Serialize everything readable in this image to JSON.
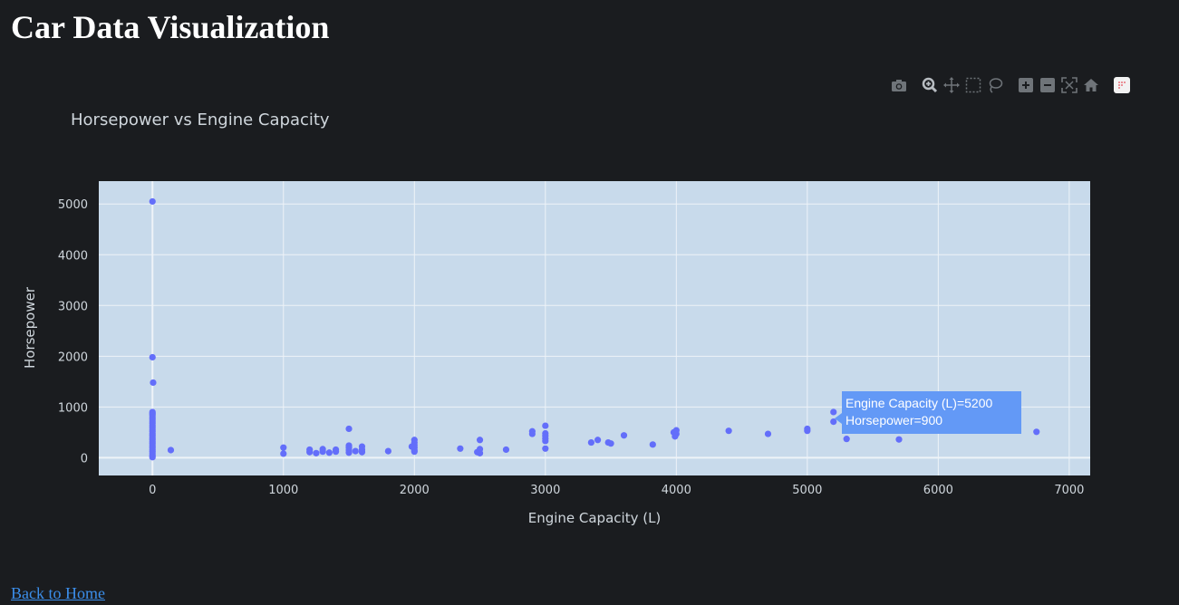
{
  "page": {
    "title": "Car Data Visualization",
    "back_link": "Back to Home"
  },
  "modebar": {
    "buttons": [
      "camera-icon",
      "zoom-icon",
      "pan-icon",
      "box-select-icon",
      "lasso-icon",
      "zoom-in-icon",
      "zoom-out-icon",
      "autoscale-icon",
      "reset-axes-icon",
      "plotly-logo-icon"
    ]
  },
  "hover": {
    "line1": "Engine Capacity (L)=5200",
    "line2": "Horsepower=900"
  },
  "chart_data": {
    "type": "scatter",
    "title": "Horsepower vs Engine Capacity",
    "xlabel": "Engine Capacity (L)",
    "ylabel": "Horsepower",
    "xlim": [
      -410,
      7160
    ],
    "ylim": [
      -350,
      5450
    ],
    "xticks": [
      0,
      1000,
      2000,
      3000,
      4000,
      5000,
      6000,
      7000
    ],
    "xtick_labels": [
      "0",
      "1000",
      "2000",
      "3000",
      "4000",
      "5000",
      "6000",
      "7000"
    ],
    "yticks": [
      0,
      1000,
      2000,
      3000,
      4000,
      5000
    ],
    "ytick_labels": [
      "0",
      "1000",
      "2000",
      "3000",
      "4000",
      "5000"
    ],
    "grid": true,
    "legend": "none",
    "colors": {
      "page_bg": "#1a1c1f",
      "plot_bg": "#c8daeb",
      "grid": "#eef3f8",
      "marker": "#636efa",
      "text": "#cfd6dc"
    },
    "points": [
      [
        0,
        5050
      ],
      [
        0,
        1980
      ],
      [
        5,
        1480
      ],
      [
        0,
        900
      ],
      [
        0,
        870
      ],
      [
        0,
        840
      ],
      [
        0,
        800
      ],
      [
        0,
        760
      ],
      [
        0,
        720
      ],
      [
        0,
        680
      ],
      [
        0,
        640
      ],
      [
        0,
        600
      ],
      [
        0,
        560
      ],
      [
        0,
        520
      ],
      [
        0,
        480
      ],
      [
        0,
        440
      ],
      [
        0,
        400
      ],
      [
        0,
        360
      ],
      [
        0,
        320
      ],
      [
        0,
        280
      ],
      [
        0,
        240
      ],
      [
        0,
        200
      ],
      [
        0,
        160
      ],
      [
        0,
        120
      ],
      [
        0,
        80
      ],
      [
        0,
        40
      ],
      [
        0,
        10
      ],
      [
        140,
        150
      ],
      [
        1000,
        200
      ],
      [
        1000,
        80
      ],
      [
        1200,
        160
      ],
      [
        1200,
        110
      ],
      [
        1250,
        90
      ],
      [
        1300,
        170
      ],
      [
        1300,
        120
      ],
      [
        1350,
        100
      ],
      [
        1400,
        160
      ],
      [
        1400,
        120
      ],
      [
        1500,
        570
      ],
      [
        1500,
        240
      ],
      [
        1500,
        200
      ],
      [
        1500,
        150
      ],
      [
        1500,
        100
      ],
      [
        1550,
        130
      ],
      [
        1600,
        220
      ],
      [
        1600,
        160
      ],
      [
        1600,
        110
      ],
      [
        1800,
        130
      ],
      [
        1980,
        220
      ],
      [
        2000,
        350
      ],
      [
        2000,
        300
      ],
      [
        2000,
        250
      ],
      [
        2000,
        200
      ],
      [
        2000,
        150
      ],
      [
        2000,
        120
      ],
      [
        2350,
        180
      ],
      [
        2500,
        350
      ],
      [
        2500,
        170
      ],
      [
        2480,
        110
      ],
      [
        2500,
        90
      ],
      [
        2700,
        160
      ],
      [
        2900,
        520
      ],
      [
        2900,
        470
      ],
      [
        3000,
        630
      ],
      [
        3000,
        480
      ],
      [
        3000,
        430
      ],
      [
        3000,
        380
      ],
      [
        3000,
        330
      ],
      [
        3000,
        180
      ],
      [
        3350,
        300
      ],
      [
        3400,
        350
      ],
      [
        3480,
        300
      ],
      [
        3500,
        280
      ],
      [
        3600,
        440
      ],
      [
        3820,
        260
      ],
      [
        4000,
        540
      ],
      [
        3980,
        500
      ],
      [
        4000,
        470
      ],
      [
        3990,
        420
      ],
      [
        4400,
        530
      ],
      [
        4700,
        470
      ],
      [
        5000,
        570
      ],
      [
        5000,
        530
      ],
      [
        5200,
        900
      ],
      [
        5200,
        710
      ],
      [
        5300,
        370
      ],
      [
        5700,
        360
      ],
      [
        6750,
        510
      ]
    ]
  }
}
